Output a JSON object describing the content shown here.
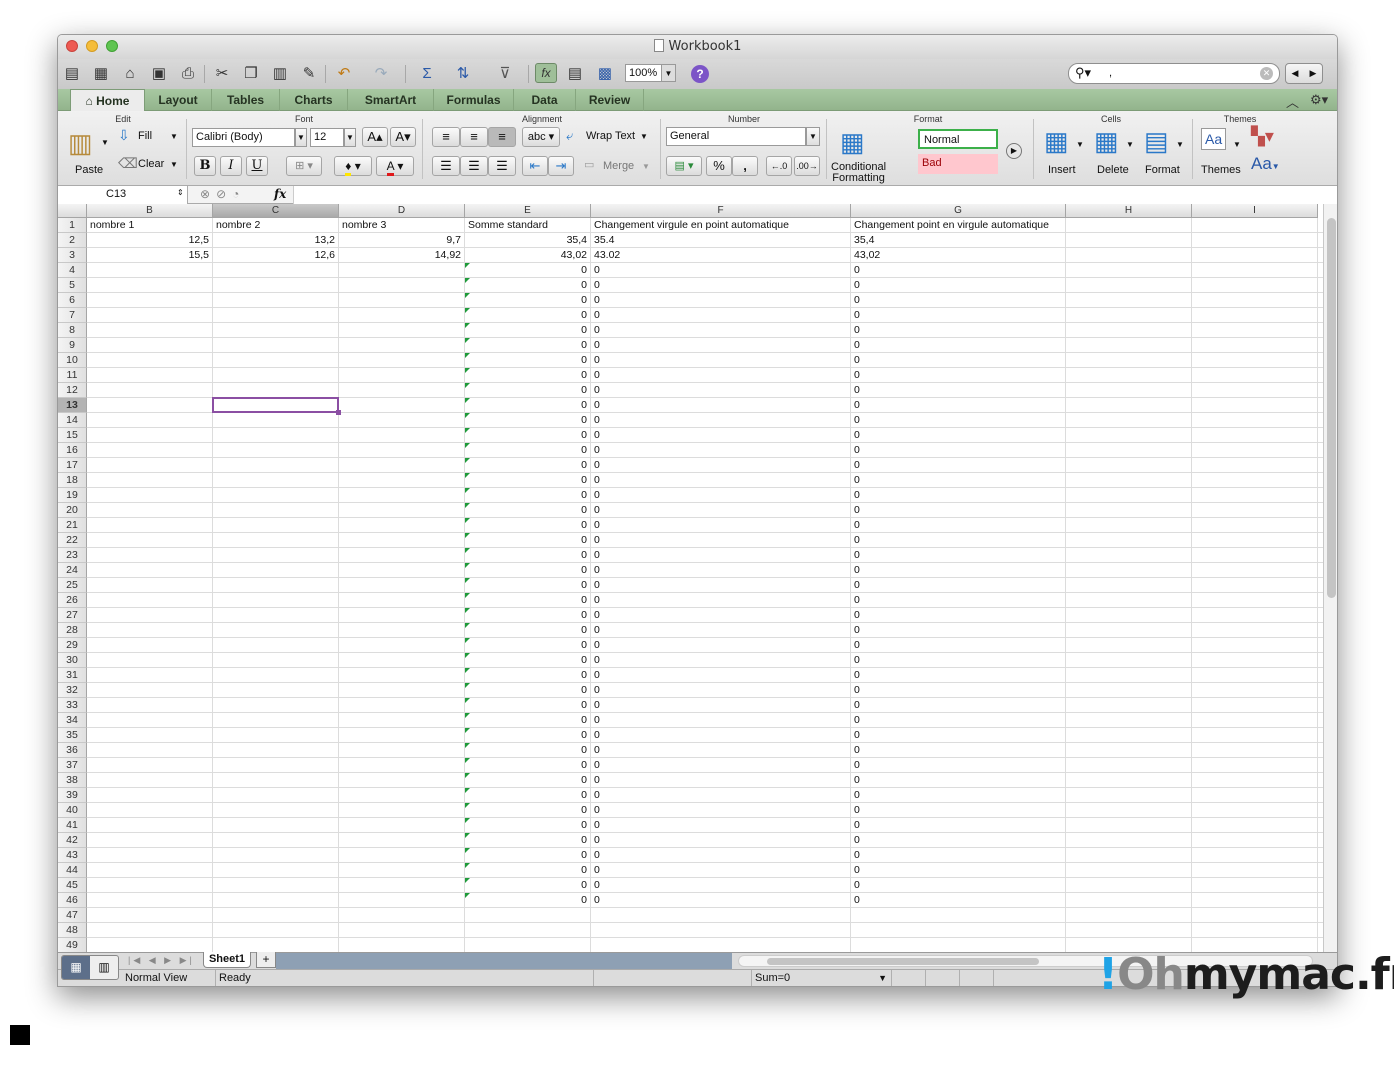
{
  "window": {
    "title": "Workbook1"
  },
  "toolbar": {
    "zoom": "100%",
    "search_value": ",",
    "help": "?"
  },
  "tabs": [
    "Home",
    "Layout",
    "Tables",
    "Charts",
    "SmartArt",
    "Formulas",
    "Data",
    "Review"
  ],
  "ribbon": {
    "edit": {
      "title": "Edit",
      "paste": "Paste",
      "fill": "Fill",
      "clear": "Clear"
    },
    "font": {
      "title": "Font",
      "family": "Calibri (Body)",
      "size": "12",
      "bold": "B",
      "italic": "I",
      "underline": "U",
      "grow": "A",
      "shrink": "A",
      "color": "A"
    },
    "alignment": {
      "title": "Alignment",
      "orientation": "abc",
      "wrap": "Wrap Text",
      "merge": "Merge"
    },
    "number": {
      "title": "Number",
      "format": "General",
      "percent": "%",
      "comma": ","
    },
    "format": {
      "title": "Format",
      "conditional_line1": "Conditional",
      "conditional_line2": "Formatting",
      "normal": "Normal",
      "bad": "Bad"
    },
    "cells": {
      "title": "Cells",
      "insert": "Insert",
      "delete": "Delete",
      "format": "Format"
    },
    "themes": {
      "title": "Themes",
      "themes": "Themes",
      "fonts": "Aa"
    }
  },
  "formula_bar": {
    "cell_ref": "C13",
    "fx": "fx",
    "value": ""
  },
  "columns": [
    "B",
    "C",
    "D",
    "E",
    "F",
    "G",
    "H",
    "I"
  ],
  "selected_column": "C",
  "selected_row": "13",
  "row_numbers": [
    "1",
    "2",
    "3",
    "4",
    "5",
    "6",
    "7",
    "8",
    "9",
    "10",
    "11",
    "12",
    "13",
    "14",
    "15",
    "16",
    "17",
    "18",
    "19",
    "20",
    "21",
    "22",
    "23",
    "24",
    "25",
    "26",
    "27",
    "28",
    "29",
    "30",
    "31",
    "32",
    "33",
    "34",
    "35",
    "36",
    "37",
    "38",
    "39",
    "40",
    "41",
    "42",
    "43",
    "44",
    "45",
    "46",
    "47",
    "48",
    "49"
  ],
  "headers_row": [
    "nombre 1",
    "nombre 2",
    "nombre 3",
    "Somme standard",
    "Changement virgule en point automatique",
    "Changement point en virgule automatique"
  ],
  "data_rows": [
    [
      "12,5",
      "13,2",
      "9,7",
      "35,4",
      "35.4",
      "35,4"
    ],
    [
      "15,5",
      "12,6",
      "14,92",
      "43,02",
      "43.02",
      "43,02"
    ]
  ],
  "zero_value": "0",
  "sheet": {
    "name": "Sheet1",
    "add": "+"
  },
  "status": {
    "view": "Normal View",
    "state": "Ready",
    "sum": "Sum=0"
  },
  "watermark": {
    "exclaim": "!",
    "oh": "Oh",
    "rest": "mymac.fr"
  },
  "colors": {
    "ribbon_tabs": "#a8c8a2",
    "selection": "#8b4fa3",
    "error_triangle": "#1f9b3b",
    "bad_fill": "#ffc7ce",
    "normal_border": "#3cb04a"
  }
}
